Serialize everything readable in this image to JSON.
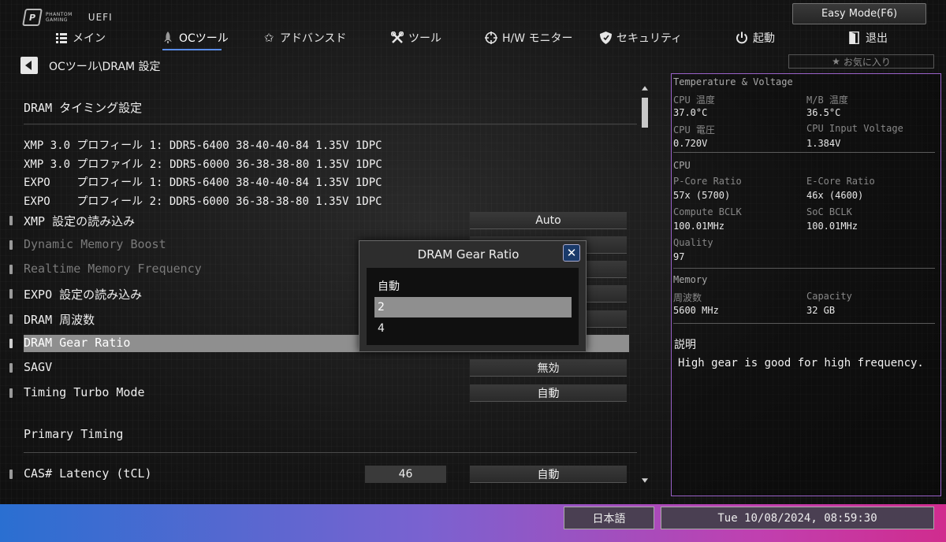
{
  "brand": {
    "logo_line1": "PHANTOM",
    "logo_line2": "GAMING",
    "uefi": "UEFI"
  },
  "easy_mode": "Easy Mode(F6)",
  "nav": [
    {
      "label": "メイン",
      "icon": "list-icon"
    },
    {
      "label": "OCツール",
      "icon": "rocket-icon",
      "active": true
    },
    {
      "label": "アドバンスド",
      "icon": "star-icon"
    },
    {
      "label": "ツール",
      "icon": "tools-icon"
    },
    {
      "label": "H/W モニター",
      "icon": "crosshair-icon"
    },
    {
      "label": "セキュリティ",
      "icon": "shield-icon"
    },
    {
      "label": "起動",
      "icon": "power-icon"
    },
    {
      "label": "退出",
      "icon": "exit-icon"
    }
  ],
  "breadcrumb": "OCツール\\DRAM 設定",
  "favorite": "お気に入り",
  "left": {
    "section_title": "DRAM タイミング設定",
    "profiles": [
      "XMP 3.0 プロフィール 1: DDR5-6400 38-40-40-84 1.35V 1DPC",
      "XMP 3.0 プロファイル 2: DDR5-6000 36-38-38-80 1.35V 1DPC",
      "EXPO    プロフィール 1: DDR5-6400 38-40-40-84 1.35V 1DPC",
      "EXPO    プロフィール 2: DDR5-6000 36-38-38-80 1.35V 1DPC"
    ],
    "settings": [
      {
        "label": "XMP 設定の読み込み",
        "value": "Auto"
      },
      {
        "label": "Dynamic Memory Boost",
        "value": "",
        "dim": true
      },
      {
        "label": "Realtime Memory Frequency",
        "value": "",
        "dim": true
      },
      {
        "label": "EXPO 設定の読み込み",
        "value": ""
      },
      {
        "label": "DRAM 周波数",
        "value": ""
      },
      {
        "label": "DRAM Gear Ratio",
        "value": "",
        "selected": true
      },
      {
        "label": "SAGV",
        "value": "無効"
      },
      {
        "label": "Timing Turbo Mode",
        "value": "自動"
      }
    ],
    "primary_timing_title": "Primary Timing",
    "cas": {
      "label": "CAS# Latency (tCL)",
      "current": "46",
      "value": "自動"
    }
  },
  "modal": {
    "title": "DRAM Gear Ratio",
    "close": "✕",
    "options": [
      "自動",
      "2",
      "4"
    ],
    "selected_index": 1
  },
  "right": {
    "tv_title": "Temperature & Voltage",
    "cpu_temp_label": "CPU 温度",
    "cpu_temp": "37.0°C",
    "mb_temp_label": "M/B 温度",
    "mb_temp": "36.5°C",
    "cpu_volt_label": "CPU 電圧",
    "cpu_volt": "0.720V",
    "cpu_input_label": "CPU Input Voltage",
    "cpu_input": "1.384V",
    "cpu_title": "CPU",
    "pcore_label": "P-Core Ratio",
    "pcore": "57x (5700)",
    "ecore_label": "E-Core Ratio",
    "ecore": "46x (4600)",
    "compute_bclk_label": "Compute BCLK",
    "compute_bclk": "100.01MHz",
    "soc_bclk_label": "SoC BCLK",
    "soc_bclk": "100.01MHz",
    "quality_label": "Quality",
    "quality": "97",
    "mem_title": "Memory",
    "freq_label": "周波数",
    "freq": "5600 MHz",
    "cap_label": "Capacity",
    "cap": "32 GB",
    "desc_title": "説明",
    "desc_text": "High gear is good for high frequency."
  },
  "bottom": {
    "language": "日本語",
    "datetime": "Tue 10/08/2024, 08:59:30"
  }
}
